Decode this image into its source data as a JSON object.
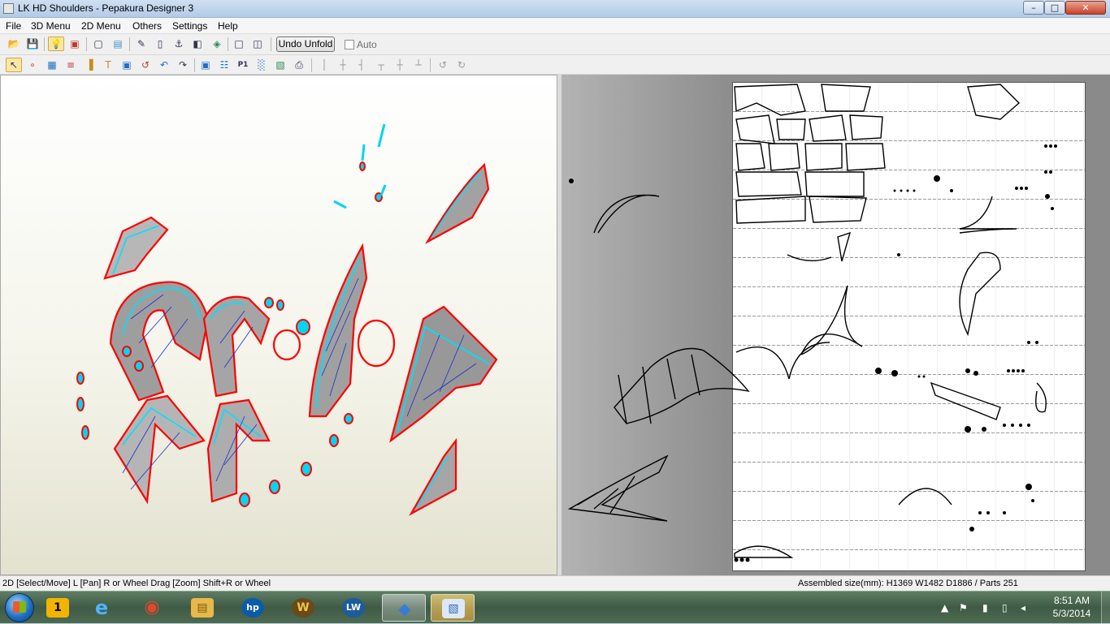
{
  "window": {
    "title": "LK HD Shoulders - Pepakura Designer 3",
    "minimize": "–",
    "maximize": "□",
    "close": "✕"
  },
  "menu": {
    "items": [
      "File",
      "3D Menu",
      "2D Menu",
      "Others",
      "Settings",
      "Help"
    ]
  },
  "toolbar1": {
    "tools": [
      {
        "name": "open-icon",
        "glyph": "📂"
      },
      {
        "name": "save-icon",
        "glyph": "💾"
      },
      {
        "name": "lightbulb-icon",
        "glyph": "💡"
      },
      {
        "name": "color-cube-icon",
        "glyph": "▣"
      },
      {
        "name": "cube-outline-icon",
        "glyph": "▢"
      },
      {
        "name": "texture-cube-icon",
        "glyph": "▤"
      },
      {
        "name": "pencil-icon",
        "glyph": "✎"
      },
      {
        "name": "cylinder-icon",
        "glyph": "▯"
      },
      {
        "name": "anchor-icon",
        "glyph": "⚓"
      },
      {
        "name": "edge-icon",
        "glyph": "◧"
      },
      {
        "name": "join-icon",
        "glyph": "◈"
      },
      {
        "name": "single-view-icon",
        "glyph": "□"
      },
      {
        "name": "split-view-icon",
        "glyph": "◫"
      }
    ],
    "undo_label": "Undo Unfold",
    "auto_label": "Auto"
  },
  "toolbar2": {
    "tools": [
      {
        "name": "select-move-icon",
        "glyph": "↖"
      },
      {
        "name": "node-icon",
        "glyph": "∘"
      },
      {
        "name": "grid-icon",
        "glyph": "▦"
      },
      {
        "name": "flaps-icon",
        "glyph": "≡"
      },
      {
        "name": "bar-icon",
        "glyph": "▐"
      },
      {
        "name": "text-icon",
        "glyph": "T"
      },
      {
        "name": "image-icon",
        "glyph": "▣"
      },
      {
        "name": "rotate-part-icon",
        "glyph": "↺"
      },
      {
        "name": "undo-icon",
        "glyph": "↶"
      },
      {
        "name": "redo-icon",
        "glyph": "↷"
      },
      {
        "name": "fit-icon",
        "glyph": "▣"
      },
      {
        "name": "arrange-icon",
        "glyph": "☷"
      },
      {
        "name": "page-one-icon",
        "glyph": "P1"
      },
      {
        "name": "chart-icon",
        "glyph": "░"
      },
      {
        "name": "page-setup-icon",
        "glyph": "▧"
      },
      {
        "name": "print-icon",
        "glyph": "⎙"
      },
      {
        "name": "align-left-icon",
        "glyph": "│"
      },
      {
        "name": "align-center-icon",
        "glyph": "┼"
      },
      {
        "name": "align-right-icon",
        "glyph": "┤"
      },
      {
        "name": "align-top-icon",
        "glyph": "┬"
      },
      {
        "name": "align-middle-icon",
        "glyph": "┼"
      },
      {
        "name": "align-bottom-icon",
        "glyph": "┴"
      },
      {
        "name": "rotate-90-ccw-icon",
        "glyph": "↺"
      },
      {
        "name": "rotate-90-cw-icon",
        "glyph": "↻"
      }
    ]
  },
  "status": {
    "left": "2D [Select/Move] L [Pan] R or Wheel Drag [Zoom] Shift+R or Wheel",
    "right": "Assembled size(mm): H1369 W1482 D1886 / Parts 251"
  },
  "taskbar": {
    "apps": [
      {
        "name": "taskbar-app-1",
        "glyph": "1",
        "color": "#f2b400"
      },
      {
        "name": "taskbar-internet-explorer",
        "glyph": "e",
        "color": "#1e88e5"
      },
      {
        "name": "taskbar-chrome",
        "glyph": "◉",
        "color": "#d93025"
      },
      {
        "name": "taskbar-explorer",
        "glyph": "▤",
        "color": "#e8b84a"
      },
      {
        "name": "taskbar-hp",
        "glyph": "hp",
        "color": "#0a5ca8"
      },
      {
        "name": "taskbar-wow",
        "glyph": "W",
        "color": "#6a4a1a"
      },
      {
        "name": "taskbar-lw",
        "glyph": "LW",
        "color": "#1c5b9c"
      },
      {
        "name": "taskbar-pepakura-3d",
        "glyph": "◆",
        "color": "#3a7bd5"
      },
      {
        "name": "taskbar-pepakura-designer",
        "glyph": "▧",
        "color": "#5b8bd6"
      }
    ],
    "time": "8:51 AM",
    "date": "5/3/2014"
  }
}
